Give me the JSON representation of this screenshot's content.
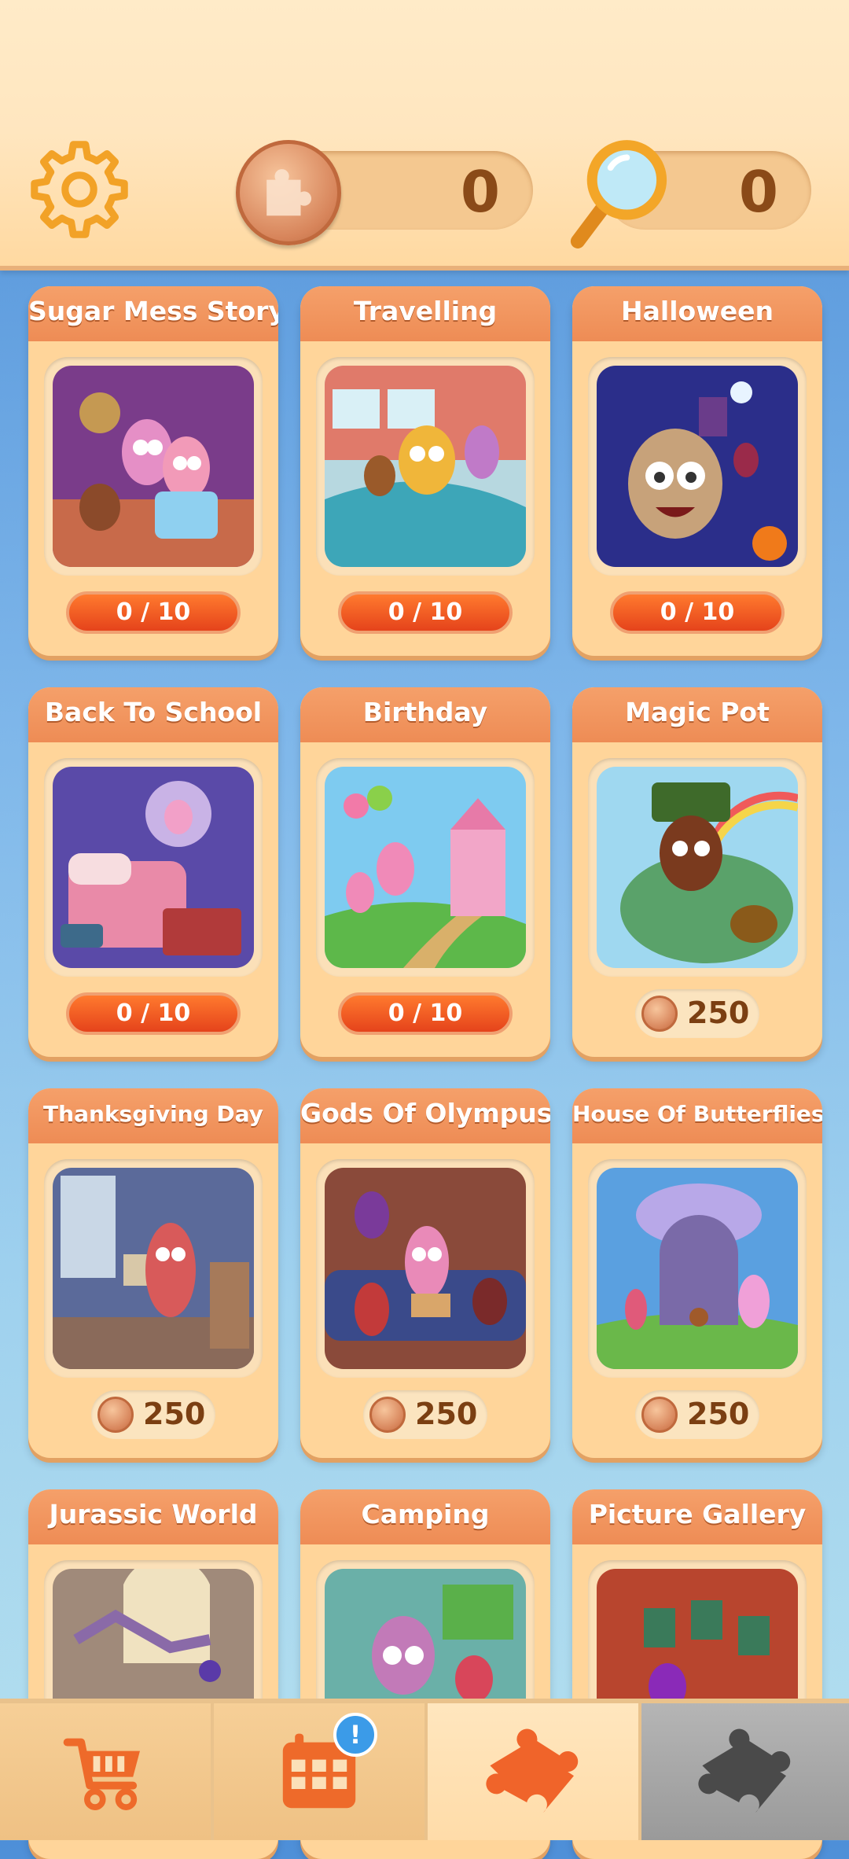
{
  "header": {
    "puzzle_count": "0",
    "hint_count": "0"
  },
  "cards": [
    {
      "title": "Sugar Mess Story",
      "progress": "0 / 10"
    },
    {
      "title": "Travelling",
      "progress": "0 / 10"
    },
    {
      "title": "Halloween",
      "progress": "0 / 10"
    },
    {
      "title": "Back To School",
      "progress": "0 / 10"
    },
    {
      "title": "Birthday",
      "progress": "0 / 10"
    },
    {
      "title": "Magic Pot",
      "price": "250"
    },
    {
      "title": "Thanksgiving Day",
      "price": "250"
    },
    {
      "title": "Gods Of Olympus",
      "price": "250"
    },
    {
      "title": "House Of Butterflies",
      "price": "250"
    },
    {
      "title": "Jurassic World"
    },
    {
      "title": "Camping"
    },
    {
      "title": "Picture Gallery"
    }
  ],
  "bottom_nav": {
    "items": [
      {
        "icon": "shopping-cart-icon"
      },
      {
        "icon": "calendar-icon",
        "badge": "!"
      },
      {
        "icon": "puzzle-piece-icon"
      },
      {
        "icon": "puzzle-gray-icon"
      }
    ]
  },
  "colors": {
    "accent_orange": "#ee8c55",
    "progress_red": "#e5431b",
    "header_bg": "#ffe6bf",
    "background_blue": "#7fb7ea"
  }
}
